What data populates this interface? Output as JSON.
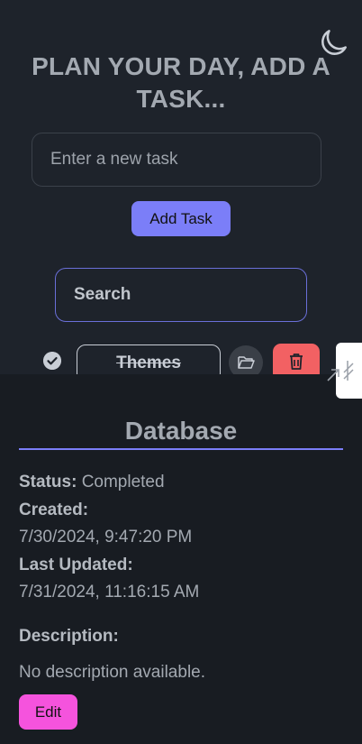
{
  "header": {
    "title": "PLAN YOUR DAY, ADD A TASK...",
    "theme_toggle_icon": "moon-icon"
  },
  "new_task": {
    "placeholder": "Enter a new task",
    "value": "",
    "add_label": "Add Task"
  },
  "search": {
    "placeholder": "Search",
    "value": ""
  },
  "task": {
    "name": "Themes",
    "completed": true,
    "icons": [
      "check-circle-icon",
      "folder-open-icon",
      "trash-icon"
    ]
  },
  "details": {
    "title": "Database",
    "status_label": "Status:",
    "status_value": "Completed",
    "created_label": "Created:",
    "created_value": "7/30/2024, 9:47:20 PM",
    "updated_label": "Last Updated:",
    "updated_value": "7/31/2024, 11:16:15 AM",
    "description_label": "Description:",
    "description_value": "No description available.",
    "edit_label": "Edit"
  },
  "colors": {
    "background": "#1e232b",
    "panel": "#181c22",
    "accent": "#7b7ef8",
    "danger": "#f26163",
    "edit": "#f553dd"
  }
}
